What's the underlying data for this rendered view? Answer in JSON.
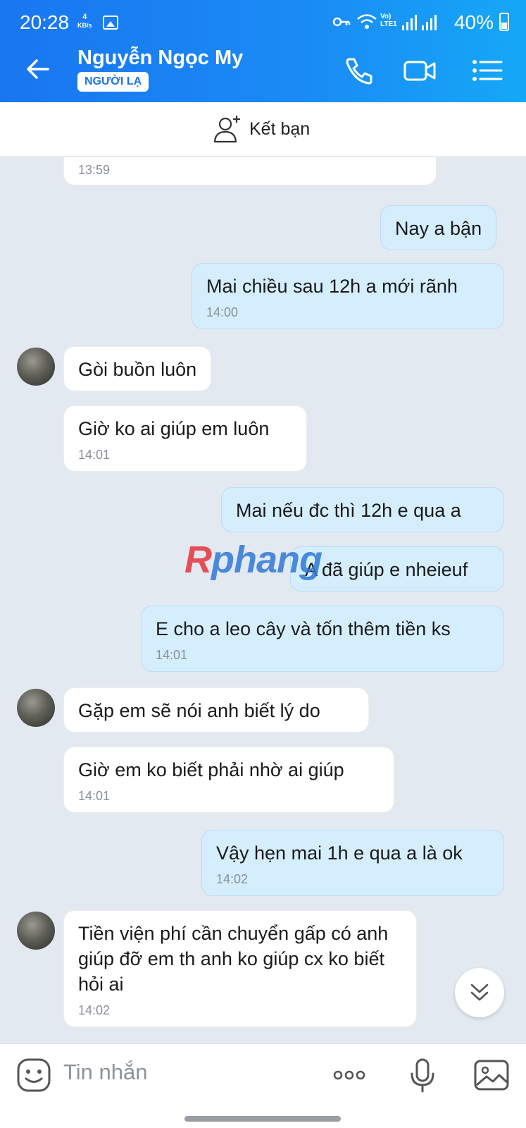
{
  "status_bar": {
    "time": "20:28",
    "net_speed_value": "4",
    "net_speed_unit": "KB/s",
    "volte_label": "Vo) LTE1",
    "battery": "40%",
    "icons": [
      "gallery-icon",
      "vpn-key-icon",
      "wifi-icon",
      "signal-icon",
      "signal-icon",
      "battery-icon"
    ]
  },
  "header": {
    "contact_name": "Nguyễn Ngọc My",
    "badge": "NGƯỜI LẠ",
    "icons": [
      "back-arrow-icon",
      "phone-icon",
      "video-call-icon",
      "menu-list-icon"
    ]
  },
  "friend_bar": {
    "label": "Kết bạn",
    "icon": "add-friend-icon"
  },
  "messages": [
    {
      "dir": "in",
      "text": "",
      "time": "13:59"
    },
    {
      "dir": "out",
      "text": "Nay a bận",
      "time": ""
    },
    {
      "dir": "out",
      "text": "Mai chiều sau 12h a mới rãnh",
      "time": "14:00"
    },
    {
      "dir": "in",
      "text": "Gòi buồn luôn",
      "time": ""
    },
    {
      "dir": "in",
      "text": "Giờ ko ai giúp em luôn",
      "time": "14:01"
    },
    {
      "dir": "out",
      "text": "Mai nếu đc thì 12h e qua a",
      "time": ""
    },
    {
      "dir": "out",
      "text": "A đã giúp e nheieuf",
      "time": ""
    },
    {
      "dir": "out",
      "text": "E cho a leo cây và tốn thêm tiền ks",
      "time": "14:01"
    },
    {
      "dir": "in",
      "text": "Gặp em sẽ nói anh biết lý do",
      "time": ""
    },
    {
      "dir": "in",
      "text": "Giờ em ko biết phải nhờ ai giúp",
      "time": "14:01"
    },
    {
      "dir": "out",
      "text": "Vậy hẹn mai 1h e qua a là ok",
      "time": "14:02"
    },
    {
      "dir": "in",
      "text": "Tiền viện phí cần chuyển gấp có anh giúp đỡ em th anh ko giúp cx ko biết hỏi ai",
      "time": "14:02"
    }
  ],
  "watermark": {
    "first": "R",
    "rest": "phang"
  },
  "input_bar": {
    "placeholder": "Tin nhắn",
    "icons": [
      "sticker-icon",
      "more-dots-icon",
      "microphone-icon",
      "image-icon"
    ]
  },
  "colors": {
    "header_start": "#1976f0",
    "header_end": "#15a8f7",
    "chat_bg": "#e2e9f1",
    "outgoing_bubble": "#d5eefd",
    "incoming_bubble": "#ffffff"
  }
}
